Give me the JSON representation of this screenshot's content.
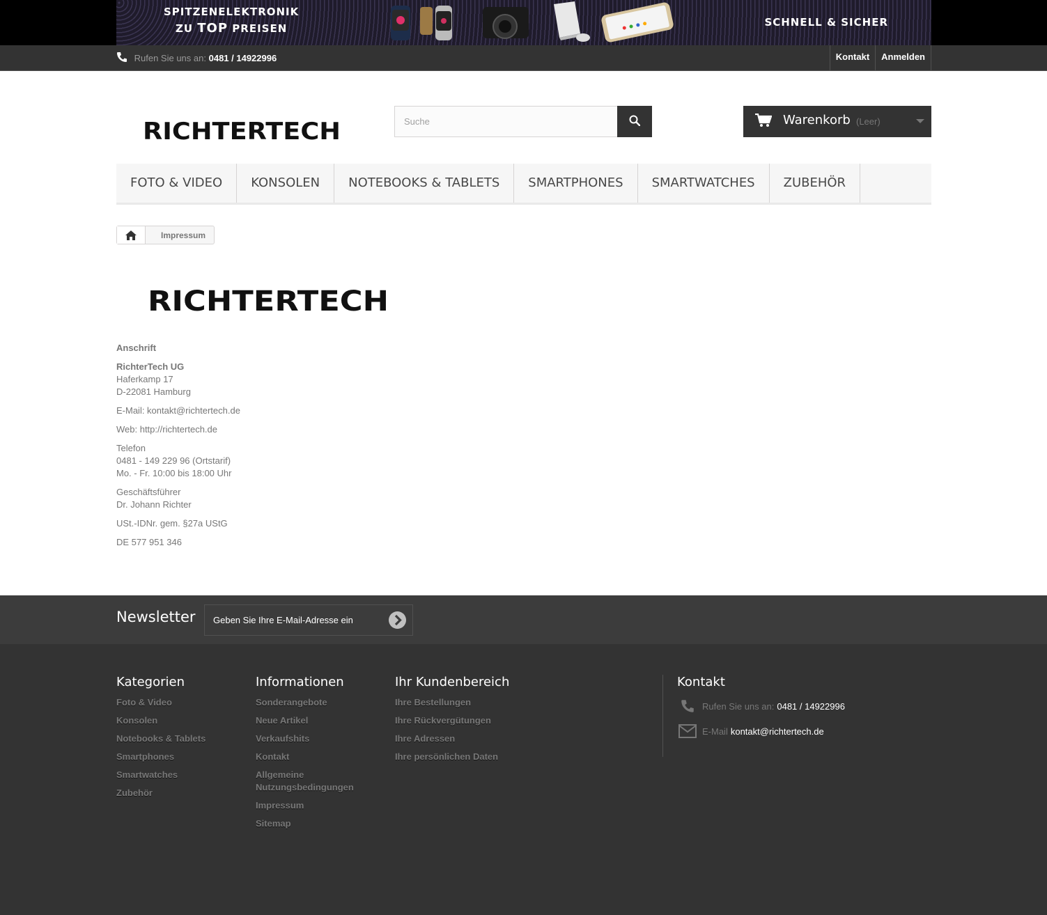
{
  "banner": {
    "line1": "SPITZENELEKTRONIK",
    "line2_prefix": "ZU",
    "line2_big": "TOP",
    "line2_suffix": "PREISEN",
    "right_text": "SCHNELL & SICHER"
  },
  "topbar": {
    "phone_prefix": "Rufen Sie uns an:",
    "phone_number": "0481 / 14922996",
    "links": [
      "Kontakt",
      "Anmelden"
    ]
  },
  "header": {
    "logo_text": "RICHTERTECH",
    "search_placeholder": "Suche",
    "cart_label": "Warenkorb",
    "cart_status": "(Leer)"
  },
  "menu": [
    "FOTO & VIDEO",
    "KONSOLEN",
    "NOTEBOOKS & TABLETS",
    "SMARTPHONES",
    "SMARTWATCHES",
    "ZUBEHÖR"
  ],
  "breadcrumb": {
    "current": "Impressum"
  },
  "impressum": {
    "heading": "Anschrift",
    "company": "RichterTech UG",
    "street": "Haferkamp 17",
    "city": "D-22081 Hamburg",
    "email": "E-Mail: kontakt@richtertech.de",
    "web": "Web: http://richtertech.de",
    "phone_label": "Telefon",
    "phone": "0481 - 149 229 96 (Ortstarif)",
    "hours": "Mo. - Fr. 10:00 bis 18:00 Uhr",
    "ceo_label": "Geschäftsführer",
    "ceo": "Dr. Johann Richter",
    "vat_label": "USt.-IDNr. gem. §27a UStG",
    "vat": "DE 577 951 346"
  },
  "newsletter": {
    "title": "Newsletter",
    "placeholder": "Geben Sie Ihre E-Mail-Adresse ein"
  },
  "footer": {
    "categories": {
      "title": "Kategorien",
      "items": [
        "Foto & Video",
        "Konsolen",
        "Notebooks & Tablets",
        "Smartphones",
        "Smartwatches",
        "Zubehör"
      ]
    },
    "information": {
      "title": "Informationen",
      "items": [
        "Sonderangebote",
        "Neue Artikel",
        "Verkaufshits",
        "Kontakt",
        "Allgemeine Nutzungsbedingungen",
        "Impressum",
        "Sitemap"
      ]
    },
    "account": {
      "title": "Ihr Kundenbereich",
      "items": [
        "Ihre Bestellungen",
        "Ihre Rückvergütungen",
        "Ihre Adressen",
        "Ihre persönlichen Daten"
      ]
    },
    "contact": {
      "title": "Kontakt",
      "phone_prefix": "Rufen Sie uns an:",
      "phone": "0481 / 14922996",
      "email_prefix": "E-Mail",
      "email": "kontakt@richtertech.de"
    }
  }
}
